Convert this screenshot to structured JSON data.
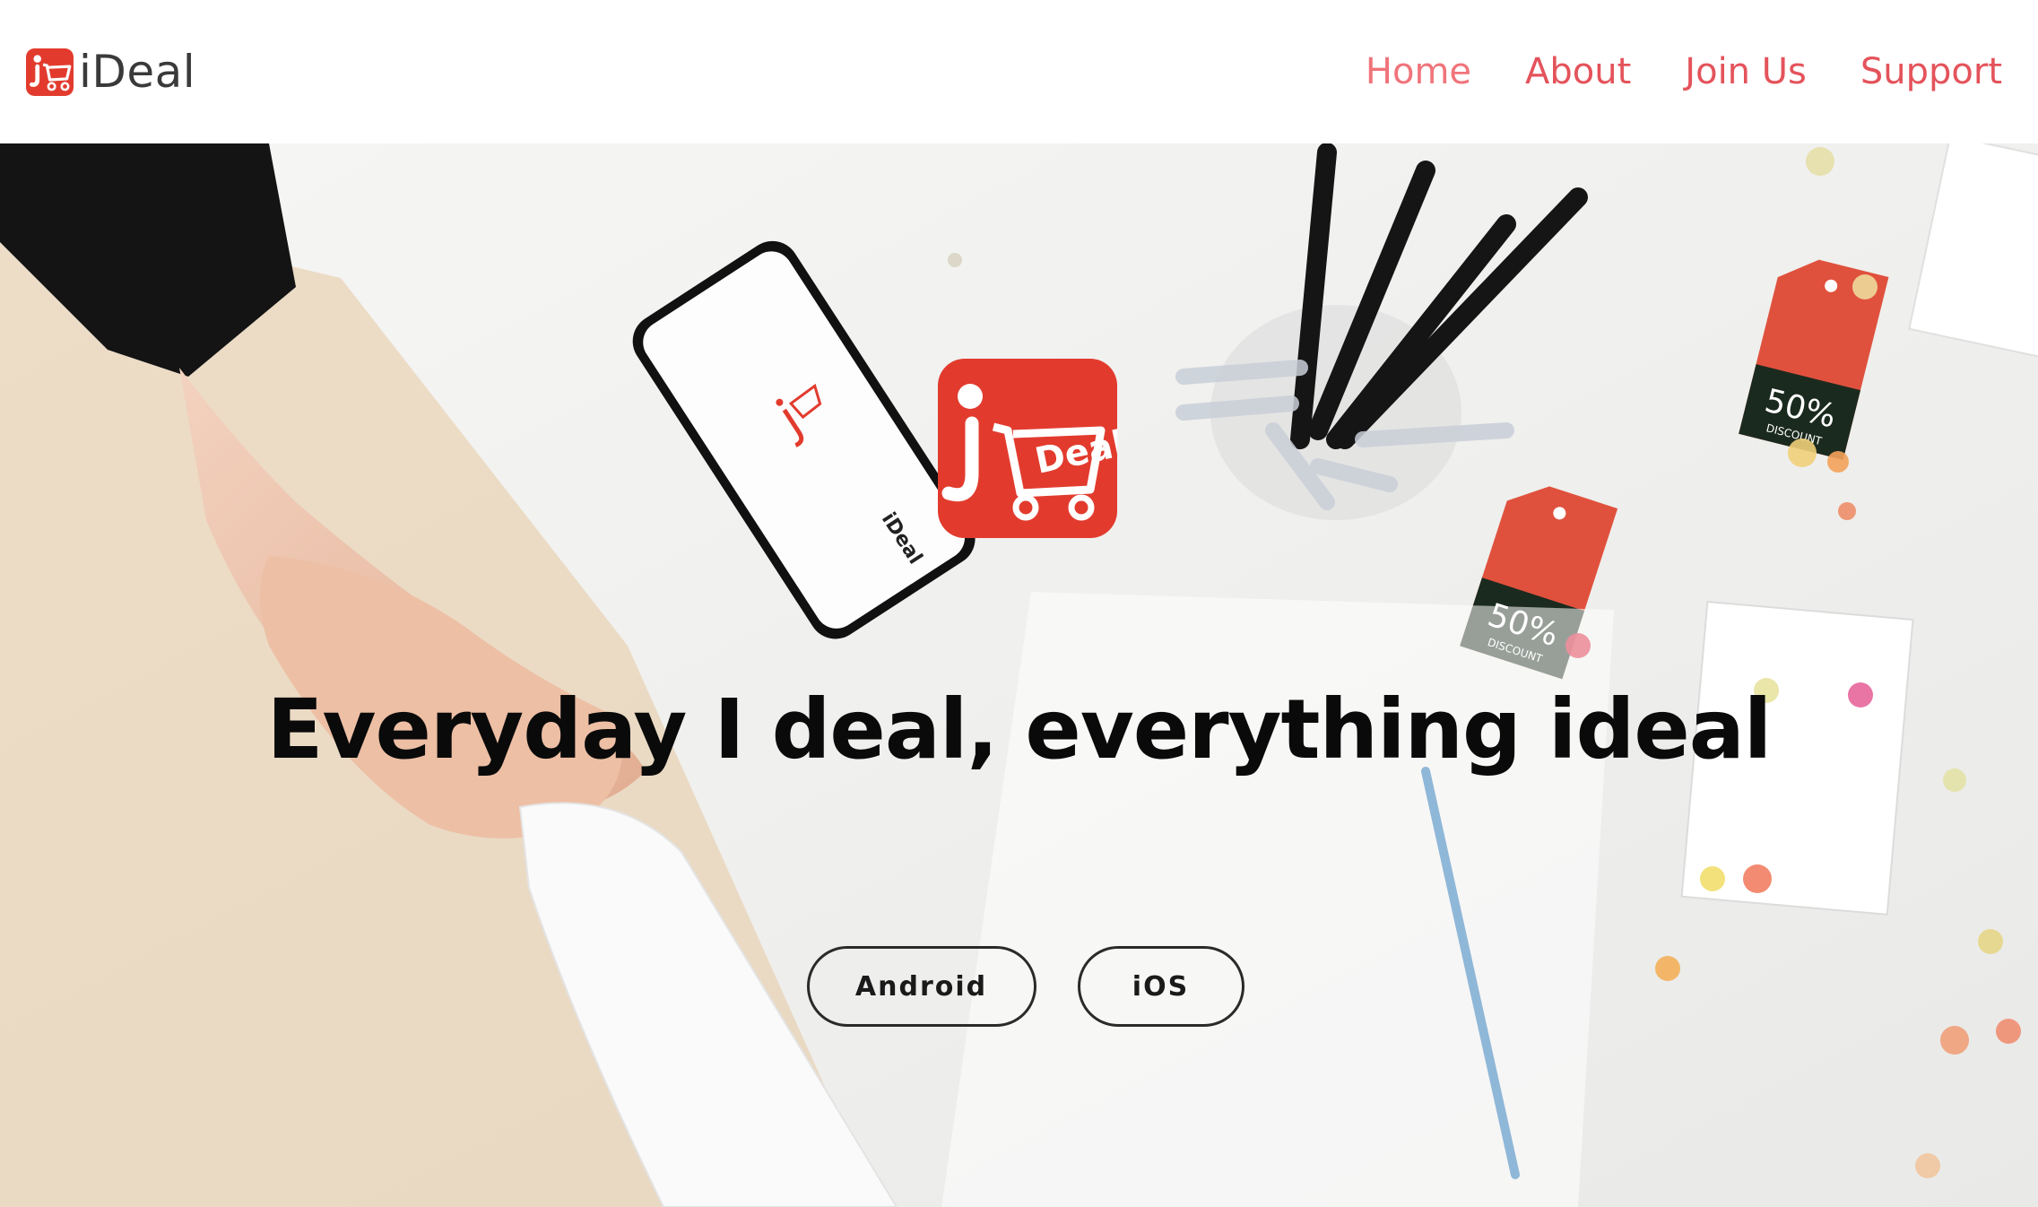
{
  "brand": {
    "name": "iDeal",
    "logo_icon": "ideal-cart-logo-icon",
    "color": "#e23b2e"
  },
  "nav": {
    "items": [
      {
        "label": "Home",
        "active": true
      },
      {
        "label": "About",
        "active": false
      },
      {
        "label": "Join Us",
        "active": false
      },
      {
        "label": "Support",
        "active": false
      }
    ],
    "color": "#e4535b"
  },
  "hero": {
    "tagline": "Everyday I deal, everything ideal",
    "app_logo_icon": "ideal-app-icon",
    "phone_screen_label": "iDeal",
    "tag_text_big": "50%",
    "tag_text_small": "DISCOUNT",
    "buttons": {
      "android": "Android",
      "ios": "iOS"
    }
  }
}
